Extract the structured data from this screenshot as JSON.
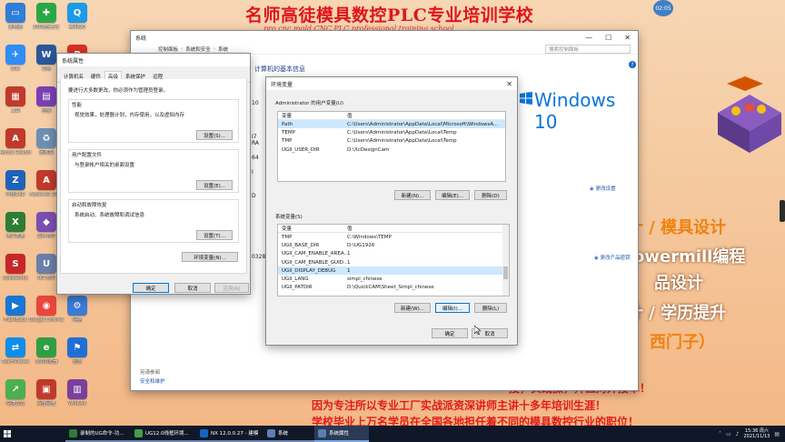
{
  "wallpaper": {
    "banner_title": "名师高徒模具数控PLC专业培训学校",
    "banner_sub": "pro cnc mold CNC PLC professional training school",
    "ad_right": [
      "计 / 模具设计",
      "owermill编程",
      "品设计",
      "计 / 学历提升",
      "、西门子）"
    ],
    "ad_bottom": [
      "授，实践操，并且对外接单！",
      "因为专注所以专业工厂实战派资深讲师主讲十多年培训生涯！",
      "学校毕业上万名学员在全国各地担任着不同的模具数控行业的职位！"
    ],
    "clock_bubble": "02:05"
  },
  "desktop_icons": [
    {
      "label": "此电脑",
      "color": "#2f7ed8",
      "glyph": "▭"
    },
    {
      "label": "360安全卫士",
      "color": "#2aa845",
      "glyph": "✚"
    },
    {
      "label": "腾讯QQ",
      "color": "#1b9ae6",
      "glyph": "Q"
    },
    {
      "label": "钉钉",
      "color": "#2f8df5",
      "glyph": "✈"
    },
    {
      "label": "文档",
      "color": "#2b579a",
      "glyph": "W"
    },
    {
      "label": "PDF",
      "color": "#d93025",
      "glyph": "P"
    },
    {
      "label": "工具",
      "color": "#c0392b",
      "glyph": "▦"
    },
    {
      "label": "压缩",
      "color": "#7b3fb5",
      "glyph": "▤"
    },
    {
      "label": "UG工具",
      "color": "#3d6fb7",
      "glyph": "U"
    },
    {
      "label": "Adobe Reader",
      "color": "#c0392b",
      "glyph": "A"
    },
    {
      "label": "回收站",
      "color": "#6d8fb3",
      "glyph": "♻"
    },
    {
      "label": "UG NX",
      "color": "#8a2432",
      "glyph": "N"
    },
    {
      "label": "中望CAD",
      "color": "#1e63b8",
      "glyph": "Z"
    },
    {
      "label": "AutoCAD 2007",
      "color": "#c0392b",
      "glyph": "A"
    },
    {
      "label": "华为",
      "color": "#d62b2b",
      "glyph": "✿"
    },
    {
      "label": "电子表格",
      "color": "#2e7d32",
      "glyph": "X"
    },
    {
      "label": "设计软件",
      "color": "#7a4fb0",
      "glyph": "◆"
    },
    {
      "label": "文档 Word",
      "color": "#2b579a",
      "glyph": "W"
    },
    {
      "label": "Solidworks",
      "color": "#c62828",
      "glyph": "S"
    },
    {
      "label": "UG 软件",
      "color": "#6b7fa8",
      "glyph": "U"
    },
    {
      "label": "VERICUT",
      "color": "#1565c0",
      "glyph": "V"
    },
    {
      "label": "FlashBack",
      "color": "#1976d2",
      "glyph": "▶"
    },
    {
      "label": "Google Chrome",
      "color": "#e8453c",
      "glyph": "◉"
    },
    {
      "label": "网络",
      "color": "#3a7bd5",
      "glyph": "⚙"
    },
    {
      "label": "TeamViewer",
      "color": "#0e8ee9",
      "glyph": "⇄"
    },
    {
      "label": "360浏览器",
      "color": "#2f9e44",
      "glyph": "e"
    },
    {
      "label": "迅雷",
      "color": "#1f6fd6",
      "glyph": "⚑"
    },
    {
      "label": "快捷方式",
      "color": "#4caf50",
      "glyph": "↗"
    },
    {
      "label": "百度网盘",
      "color": "#c0392b",
      "glyph": "▣"
    },
    {
      "label": "WinRAR",
      "color": "#7b3f9c",
      "glyph": "▥"
    }
  ],
  "system_window": {
    "title": "系统",
    "breadcrumb": [
      "控制面板",
      "系统和安全",
      "系统"
    ],
    "search_placeholder": "搜索控制面板",
    "heading": "计算机的基本信息",
    "windows_brand": "Windows 10",
    "activation_link": "更改设置",
    "product_key_link": "更改产品密钥",
    "see_also": "另请参阅",
    "security_link": "安全和维护",
    "left_values": [
      "10",
      "I7",
      "RA",
      "64",
      "I",
      "D",
      "0328-"
    ]
  },
  "sysprops": {
    "title": "系统属性",
    "tabs": [
      "计算机名",
      "硬件",
      "高级",
      "系统保护",
      "远程"
    ],
    "active_tab": 2,
    "admin_note": "要进行大多数更改，你必须作为管理员登录。",
    "groups": [
      {
        "title": "性能",
        "desc": "视觉效果，处理器计划，内存使用，以及虚拟内存",
        "button": "设置(S)..."
      },
      {
        "title": "用户配置文件",
        "desc": "与登录帐户相关的桌面设置",
        "button": "设置(E)..."
      },
      {
        "title": "启动和故障恢复",
        "desc": "系统启动、系统故障和调试信息",
        "button": "设置(T)..."
      }
    ],
    "env_button": "环境变量(N)...",
    "ok": "确定",
    "cancel": "取消",
    "apply": "应用(A)"
  },
  "envvars": {
    "title": "环境变量",
    "user_section": "Administrator 的用户变量(U)",
    "col_var": "变量",
    "col_val": "值",
    "user_vars": [
      {
        "name": "Path",
        "value": "C:\\Users\\Administrator\\AppData\\Local\\Microsoft\\WindowsA..."
      },
      {
        "name": "TEMP",
        "value": "C:\\Users\\Administrator\\AppData\\Local\\Temp"
      },
      {
        "name": "TMP",
        "value": "C:\\Users\\Administrator\\AppData\\Local\\Temp"
      },
      {
        "name": "UGII_USER_DIR",
        "value": "D:\\XcDesignCam"
      }
    ],
    "user_buttons": [
      "新建(N)...",
      "编辑(E)...",
      "删除(D)"
    ],
    "sys_section": "系统变量(S)",
    "sys_vars": [
      {
        "name": "TMP",
        "value": "C:\\Windows\\TEMP"
      },
      {
        "name": "UGII_BASE_DIR",
        "value": "D:\\UG1926"
      },
      {
        "name": "UGII_CAM_ENABLE_AREA...",
        "value": "1"
      },
      {
        "name": "UGII_CAM_ENABLE_GUID...",
        "value": "1"
      },
      {
        "name": "UGII_DISPLAY_DEBUG",
        "value": "1"
      },
      {
        "name": "UGII_LANG",
        "value": "simpl_chinese"
      },
      {
        "name": "UGII_PATDIR",
        "value": "D:\\QuickCAM\\Sheet_Simpl_chinese"
      }
    ],
    "sys_buttons": [
      "新建(W)...",
      "编辑(I)...",
      "删除(L)"
    ],
    "ok": "确定",
    "cancel": "取消"
  },
  "taskbar": {
    "items": [
      {
        "label": "录制的UG命令-功...",
        "color": "#2e7d32"
      },
      {
        "label": "UG12.0线框环境...",
        "color": "#43a047"
      },
      {
        "label": "NX 12.0.0.27 - 建模",
        "color": "#1565c0"
      },
      {
        "label": "系统",
        "color": "#5c7fb0"
      },
      {
        "label": "系统属性",
        "color": "#5c7fb0"
      }
    ],
    "time": "15:36 周六",
    "date": "2021/11/13"
  }
}
